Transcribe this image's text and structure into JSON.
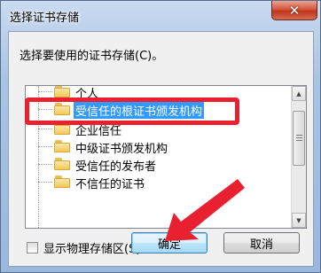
{
  "window": {
    "title": "选择证书存储",
    "close_glyph": "✕"
  },
  "dialog": {
    "prompt": "选择要使用的证书存储(C)。",
    "tree_items": [
      {
        "label": "个人",
        "selected": false
      },
      {
        "label": "受信任的根证书颁发机构",
        "selected": true
      },
      {
        "label": "企业信任",
        "selected": false
      },
      {
        "label": "中级证书颁发机构",
        "selected": false
      },
      {
        "label": "受信任的发布者",
        "selected": false
      },
      {
        "label": "不信任的证书",
        "selected": false
      }
    ],
    "show_physical_label": "显示物理存储区(S)",
    "show_physical_checked": false,
    "ok_label": "确定",
    "cancel_label": "取消"
  },
  "annotations": {
    "highlight_color": "#e8202f",
    "arrow_color": "#e8202f"
  },
  "colors": {
    "selection": "#3399ff",
    "close_button": "#c0341d"
  },
  "icons": {
    "tree_item": "folder-icon",
    "scroll_up": "arrow-up-icon",
    "scroll_down": "arrow-down-icon"
  }
}
